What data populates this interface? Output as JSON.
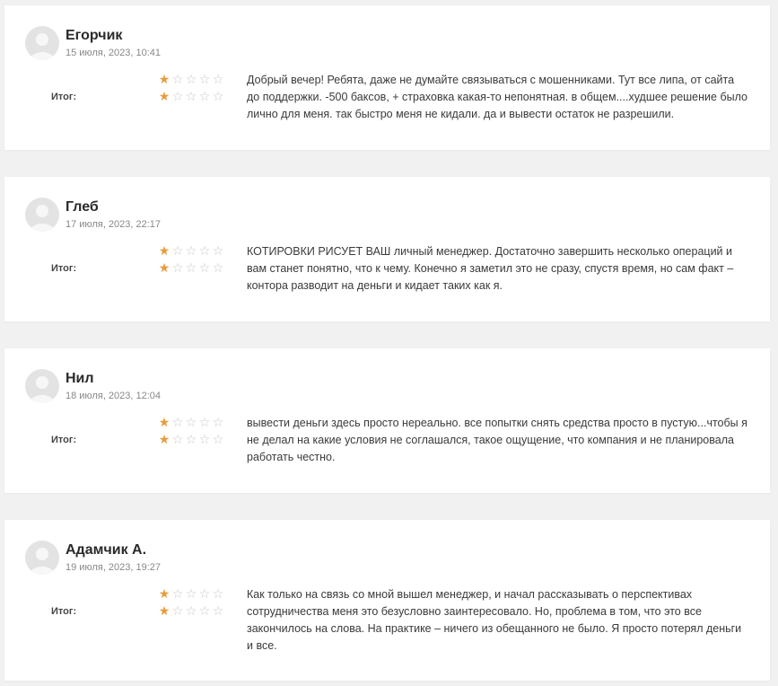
{
  "colors": {
    "star_filled": "#e89b3c",
    "star_empty": "#c8c8c8",
    "background": "#f1f1f1",
    "card": "#ffffff"
  },
  "total_label": "Итог:",
  "reviews": [
    {
      "author": "Егорчик",
      "date": "15 июля, 2023, 10:41",
      "rating": 1,
      "max_rating": 5,
      "text": "Добрый вечер! Ребята, даже не думайте связываться с мошенниками. Тут все липа, от сайта до поддержки. -500 баксов, + страховка какая-то непонятная. в общем....худшее решение было лично для меня. так быстро меня не кидали. да и вывести остаток не разрешили."
    },
    {
      "author": "Глеб",
      "date": "17 июля, 2023, 22:17",
      "rating": 1,
      "max_rating": 5,
      "text": "КОТИРОВКИ РИСУЕТ ВАШ личный менеджер. Достаточно завершить несколько операций и вам станет понятно, что к чему. Конечно я заметил это не сразу, спустя время, но сам факт – контора разводит на деньги и кидает таких как я."
    },
    {
      "author": "Нил",
      "date": "18 июля, 2023, 12:04",
      "rating": 1,
      "max_rating": 5,
      "text": "вывести деньги здесь просто нереально. все попытки снять средства просто в пустую...чтобы я не делал на какие условия не соглашался, такое ощущение, что компания и не планировала работать честно."
    },
    {
      "author": "Адамчик А.",
      "date": "19 июля, 2023, 19:27",
      "rating": 1,
      "max_rating": 5,
      "text": "Как только на связь со мной вышел менеджер, и начал рассказывать о перспективах сотрудничества меня это безусловно заинтересовало. Но, проблема в том, что это все закончилось на слова. На практике – ничего из обещанного не было. Я просто потерял деньги и все."
    }
  ]
}
